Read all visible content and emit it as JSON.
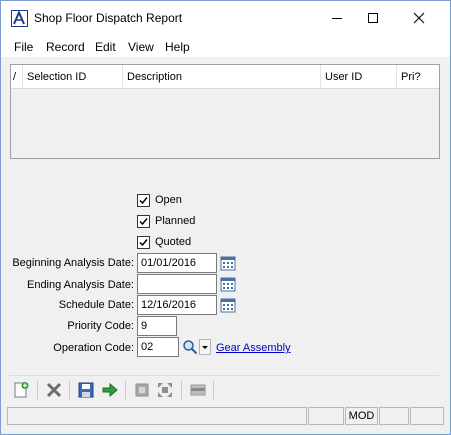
{
  "window": {
    "title": "Shop Floor Dispatch Report"
  },
  "menu": {
    "file": "File",
    "record": "Record",
    "edit": "Edit",
    "view": "View",
    "help": "Help"
  },
  "grid": {
    "columns": {
      "flag": "/",
      "selection_id": "Selection ID",
      "description": "Description",
      "user_id": "User ID",
      "pri": "Pri?"
    },
    "rows": []
  },
  "options": {
    "open": {
      "label": "Open",
      "checked": true
    },
    "planned": {
      "label": "Planned",
      "checked": true
    },
    "quoted": {
      "label": "Quoted",
      "checked": true
    }
  },
  "fields": {
    "beginning_analysis_date": {
      "label": "Beginning Analysis Date:",
      "value": "01/01/2016"
    },
    "ending_analysis_date": {
      "label": "Ending Analysis Date:",
      "value": ""
    },
    "schedule_date": {
      "label": "Schedule Date:",
      "value": "12/16/2016"
    },
    "priority_code": {
      "label": "Priority Code:",
      "value": "9"
    },
    "operation_code": {
      "label": "Operation Code:",
      "value": "02",
      "link": "Gear Assembly"
    }
  },
  "toolbar": {
    "icons": [
      "new-record-icon",
      "delete-icon",
      "save-icon",
      "proceed-arrow-icon",
      "print-preview-icon",
      "expand-icon",
      "bar-icon"
    ]
  },
  "status": {
    "mode": "MOD"
  }
}
